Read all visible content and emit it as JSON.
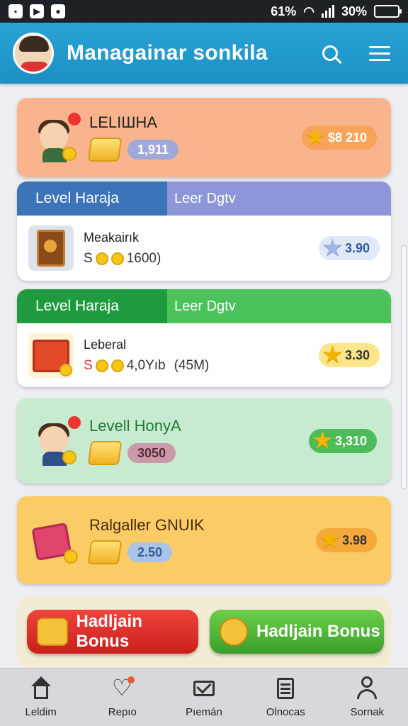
{
  "status_bar": {
    "left_icons": [
      "notification-icon",
      "play-icon",
      "circle-icon"
    ],
    "signal_text": "61%",
    "battery_text": "30%",
    "battery_level": 0.3
  },
  "header": {
    "title": "Managainar sonkila"
  },
  "cards": {
    "top": {
      "title": "LELIШHA",
      "badge": "1,911",
      "stars": "$8 210",
      "color": "#f8b48c"
    },
    "section1": {
      "left_tab": "Level Haraja",
      "right_tab": "Leer Dgtv",
      "item_title": "Meakairık",
      "meta_prefix": "S",
      "meta_value": "1600)",
      "stars": "3.90"
    },
    "section2": {
      "left_tab": "Level Haraja",
      "right_tab": "Leer Dgtv",
      "item_title": "Leberal",
      "meta_prefix": "S",
      "meta_value": "4,0Yıb",
      "meta_extra": "(45M)",
      "stars": "3.30"
    },
    "green": {
      "title": "Levell HonyA",
      "badge": "3050",
      "stars": "3,310"
    },
    "yellow": {
      "title": "Ralgaller GNUIK",
      "badge": "2.50",
      "stars": "3.98"
    }
  },
  "bonus_buttons": [
    {
      "label": "Hadljain Bonus"
    },
    {
      "label": "Hadljain Bonus"
    }
  ],
  "bottom_nav": [
    {
      "label": "Leldim",
      "icon": "home-icon"
    },
    {
      "label": "Repıo",
      "icon": "heart-icon"
    },
    {
      "label": "Pıemán",
      "icon": "mail-icon"
    },
    {
      "label": "Olnocas",
      "icon": "clipboard-icon"
    },
    {
      "label": "Sornak",
      "icon": "user-icon"
    }
  ]
}
